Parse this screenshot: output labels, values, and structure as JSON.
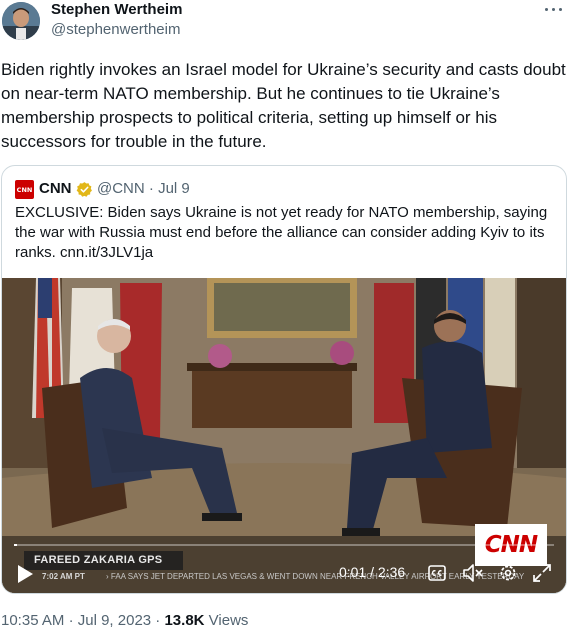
{
  "author": {
    "name": "Stephen Wertheim",
    "handle": "@stephenwertheim",
    "avatar_icon": "avatar-photo"
  },
  "tweet": {
    "text": "Biden rightly invokes an Israel model for Ukraine’s security and casts doubt on near-term NATO membership. But he continues to tie Ukraine’s membership prospects to political criteria, setting up himself or his successors for trouble in the future."
  },
  "quote": {
    "name": "CNN",
    "logo_text": "CNN",
    "handle": "@CNN",
    "separator": "·",
    "date": "Jul 9",
    "text": "EXCLUSIVE: Biden says Ukraine is not yet ready for NATO membership, saying the war with Russia must end before the alliance can consider adding Kyiv to its ranks. cnn.it/3JLV1ja",
    "verified_color": "#e2b719"
  },
  "video": {
    "lower_third": "FAREED ZAKARIA GPS",
    "ticker_time": "7:02 AM PT",
    "ticker_text": "› FAA SAYS JET DEPARTED LAS VEGAS & WENT DOWN NEAR FRENCH VALLEY AIRPORT EARLY YESTERDAY",
    "network_bug": "CNN",
    "time_readout": "0:01 / 2:36",
    "progress_fraction": 0.006
  },
  "meta": {
    "time": "10:35 AM",
    "sep1": "·",
    "date": "Jul 9, 2023",
    "sep2": "·",
    "views_count": "13.8K",
    "views_label": "Views"
  },
  "colors": {
    "text_primary": "#0f1419",
    "text_secondary": "#536471",
    "border": "#cfd9de",
    "cnn_red": "#cc0000"
  }
}
